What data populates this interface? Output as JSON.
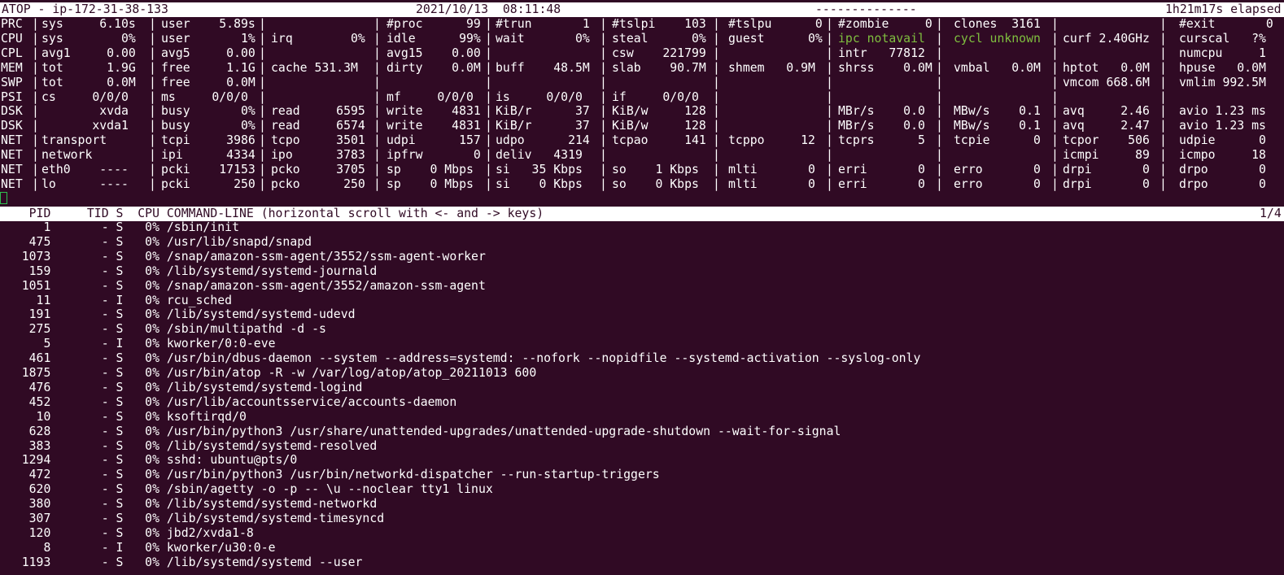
{
  "title_bar": {
    "host": "ATOP - ip-172-31-38-133",
    "datetime": "2021/10/13  08:11:48",
    "dashes": "--------------",
    "elapsed": "1h21m17s elapsed"
  },
  "system_rows": [
    {
      "label": "PRC",
      "cells": [
        "sys     6.10s",
        "user    5.89s",
        "",
        "#proc      99",
        "#trun       1",
        "#tslpi    103",
        "#tslpu      0",
        "#zombie     0",
        "clones  3161",
        "",
        "#exit       0"
      ]
    },
    {
      "label": "CPU",
      "cells": [
        "sys        0%",
        "user       1%",
        "irq        0%",
        "idle      99%",
        "wait       0%",
        "steal      0%",
        "guest      0%",
        "ipc notavail",
        "cycl unknown",
        "curf 2.40GHz",
        "curscal   ?%"
      ]
    },
    {
      "label": "CPL",
      "cells": [
        "avg1     0.00",
        "avg5     0.00",
        "",
        "avg15    0.00",
        "",
        "csw    221799",
        "",
        "intr   77812",
        "",
        "",
        "numcpu     1"
      ]
    },
    {
      "label": "MEM",
      "cells": [
        "tot      1.9G",
        "free     1.1G",
        "cache 531.3M",
        "dirty    0.0M",
        "buff    48.5M",
        "slab    90.7M",
        "shmem   0.9M",
        "shrss    0.0M",
        "vmbal   0.0M",
        "hptot   0.0M",
        "hpuse   0.0M"
      ]
    },
    {
      "label": "SWP",
      "cells": [
        "tot      0.0M",
        "free     0.0M",
        "",
        "",
        "",
        "",
        "",
        "",
        "",
        "vmcom 668.6M",
        "vmlim 992.5M"
      ]
    },
    {
      "label": "PSI",
      "cells": [
        "cs     0/0/0",
        "ms     0/0/0",
        "",
        "mf     0/0/0",
        "is     0/0/0",
        "if     0/0/0",
        "",
        "",
        "",
        "",
        ""
      ]
    },
    {
      "label": "DSK",
      "cells": [
        "        xvda",
        "busy       0%",
        "read     6595",
        "write    4831",
        "KiB/r      37",
        "KiB/w     128",
        "",
        "MBr/s    0.0",
        "MBw/s    0.1",
        "avq     2.46",
        "avio 1.23 ms"
      ]
    },
    {
      "label": "DSK",
      "cells": [
        "       xvda1",
        "busy       0%",
        "read     6574",
        "write    4831",
        "KiB/r      37",
        "KiB/w     128",
        "",
        "MBr/s    0.0",
        "MBw/s    0.1",
        "avq     2.47",
        "avio 1.23 ms"
      ]
    },
    {
      "label": "NET",
      "cells": [
        "transport",
        "tcpi     3986",
        "tcpo     3501",
        "udpi      157",
        "udpo      214",
        "tcpao     141",
        "tcppo     12",
        "tcprs      5",
        "tcpie      0",
        "tcpor    506",
        "udpie      0"
      ]
    },
    {
      "label": "NET",
      "cells": [
        "network",
        "ipi      4334",
        "ipo      3783",
        "ipfrw       0",
        "deliv   4319",
        "",
        "",
        "",
        "",
        "icmpi     89",
        "icmpo     18"
      ]
    },
    {
      "label": "NET",
      "cells": [
        "eth0    ----",
        "pcki    17153",
        "pcko     3705",
        "sp    0 Mbps",
        "si   35 Kbps",
        "so    1 Kbps",
        "mlti       0",
        "erri       0",
        "erro       0",
        "drpi       0",
        "drpo       0"
      ]
    },
    {
      "label": "NET",
      "cells": [
        "lo      ----",
        "pcki      250",
        "pcko      250",
        "sp    0 Mbps",
        "si    0 Kbps",
        "so    0 Kbps",
        "mlti       0",
        "erri       0",
        "erro       0",
        "drpi       0",
        "drpo       0"
      ]
    }
  ],
  "process_header": {
    "text": "    PID     TID S  CPU COMMAND-LINE (horizontal scroll with <- and -> keys)",
    "page": "1/4"
  },
  "processes": [
    {
      "pid": "1",
      "tid": "-",
      "s": "S",
      "cpu": "0%",
      "cmd": "/sbin/init"
    },
    {
      "pid": "475",
      "tid": "-",
      "s": "S",
      "cpu": "0%",
      "cmd": "/usr/lib/snapd/snapd"
    },
    {
      "pid": "1073",
      "tid": "-",
      "s": "S",
      "cpu": "0%",
      "cmd": "/snap/amazon-ssm-agent/3552/ssm-agent-worker"
    },
    {
      "pid": "159",
      "tid": "-",
      "s": "S",
      "cpu": "0%",
      "cmd": "/lib/systemd/systemd-journald"
    },
    {
      "pid": "1051",
      "tid": "-",
      "s": "S",
      "cpu": "0%",
      "cmd": "/snap/amazon-ssm-agent/3552/amazon-ssm-agent"
    },
    {
      "pid": "11",
      "tid": "-",
      "s": "I",
      "cpu": "0%",
      "cmd": "rcu_sched"
    },
    {
      "pid": "191",
      "tid": "-",
      "s": "S",
      "cpu": "0%",
      "cmd": "/lib/systemd/systemd-udevd"
    },
    {
      "pid": "275",
      "tid": "-",
      "s": "S",
      "cpu": "0%",
      "cmd": "/sbin/multipathd -d -s"
    },
    {
      "pid": "5",
      "tid": "-",
      "s": "I",
      "cpu": "0%",
      "cmd": "kworker/0:0-eve"
    },
    {
      "pid": "461",
      "tid": "-",
      "s": "S",
      "cpu": "0%",
      "cmd": "/usr/bin/dbus-daemon --system --address=systemd: --nofork --nopidfile --systemd-activation --syslog-only"
    },
    {
      "pid": "1875",
      "tid": "-",
      "s": "S",
      "cpu": "0%",
      "cmd": "/usr/bin/atop -R -w /var/log/atop/atop_20211013 600"
    },
    {
      "pid": "476",
      "tid": "-",
      "s": "S",
      "cpu": "0%",
      "cmd": "/lib/systemd/systemd-logind"
    },
    {
      "pid": "452",
      "tid": "-",
      "s": "S",
      "cpu": "0%",
      "cmd": "/usr/lib/accountsservice/accounts-daemon"
    },
    {
      "pid": "10",
      "tid": "-",
      "s": "S",
      "cpu": "0%",
      "cmd": "ksoftirqd/0"
    },
    {
      "pid": "628",
      "tid": "-",
      "s": "S",
      "cpu": "0%",
      "cmd": "/usr/bin/python3 /usr/share/unattended-upgrades/unattended-upgrade-shutdown --wait-for-signal"
    },
    {
      "pid": "383",
      "tid": "-",
      "s": "S",
      "cpu": "0%",
      "cmd": "/lib/systemd/systemd-resolved"
    },
    {
      "pid": "1294",
      "tid": "-",
      "s": "S",
      "cpu": "0%",
      "cmd": "sshd: ubuntu@pts/0"
    },
    {
      "pid": "472",
      "tid": "-",
      "s": "S",
      "cpu": "0%",
      "cmd": "/usr/bin/python3 /usr/bin/networkd-dispatcher --run-startup-triggers"
    },
    {
      "pid": "620",
      "tid": "-",
      "s": "S",
      "cpu": "0%",
      "cmd": "/sbin/agetty -o -p -- \\u --noclear tty1 linux"
    },
    {
      "pid": "380",
      "tid": "-",
      "s": "S",
      "cpu": "0%",
      "cmd": "/lib/systemd/systemd-networkd"
    },
    {
      "pid": "307",
      "tid": "-",
      "s": "S",
      "cpu": "0%",
      "cmd": "/lib/systemd/systemd-timesyncd"
    },
    {
      "pid": "120",
      "tid": "-",
      "s": "S",
      "cpu": "0%",
      "cmd": "jbd2/xvda1-8"
    },
    {
      "pid": "8",
      "tid": "-",
      "s": "I",
      "cpu": "0%",
      "cmd": "kworker/u30:0-e"
    },
    {
      "pid": "1193",
      "tid": "-",
      "s": "S",
      "cpu": "0%",
      "cmd": "/lib/systemd/systemd --user"
    }
  ],
  "colors": {
    "background": "#300a24",
    "foreground": "#ffffff",
    "highlight_green": "#7fbf3f"
  }
}
